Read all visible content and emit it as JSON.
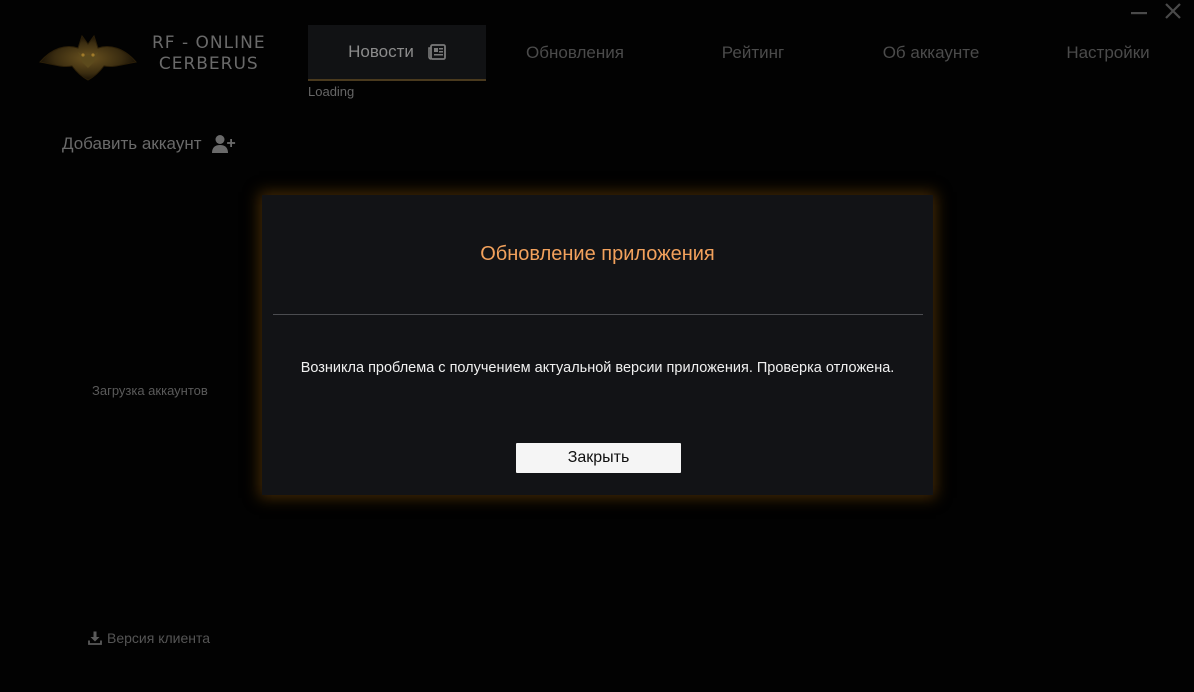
{
  "app": {
    "logo_line1": "RF - ONLINE",
    "logo_line2": "CERBERUS"
  },
  "nav": {
    "tabs": [
      {
        "label": "Новости",
        "active": true
      },
      {
        "label": "Обновления",
        "active": false
      },
      {
        "label": "Рейтинг",
        "active": false
      },
      {
        "label": "Об аккаунте",
        "active": false
      },
      {
        "label": "Настройки",
        "active": false
      }
    ],
    "loading_text": "Loading"
  },
  "sidebar": {
    "add_account_label": "Добавить аккаунт",
    "loading_accounts": "Загрузка аккаунтов",
    "client_version_label": "Версия клиента"
  },
  "modal": {
    "title": "Обновление приложения",
    "message": "Возникла проблема с получением актуальной версии приложения. Проверка отложена.",
    "close_label": "Закрыть"
  },
  "colors": {
    "accent_title": "#f2a15c",
    "modal_glow": "#784808",
    "modal_bg": "#121316"
  },
  "icons": {
    "minimize": "minimize-icon",
    "close": "close-icon",
    "news": "newspaper-icon",
    "add_user": "user-plus-icon",
    "download": "download-icon"
  }
}
